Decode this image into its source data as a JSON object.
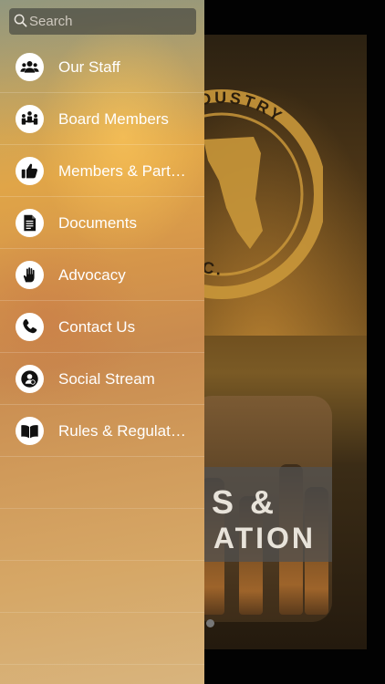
{
  "search": {
    "placeholder": "Search",
    "value": ""
  },
  "menu": {
    "items": [
      {
        "label": "Our Staff",
        "icon": "staff-group-icon"
      },
      {
        "label": "Board Members",
        "icon": "board-members-icon"
      },
      {
        "label": "Members & Part…",
        "icon": "thumbs-up-icon"
      },
      {
        "label": "Documents",
        "icon": "document-icon"
      },
      {
        "label": "Advocacy",
        "icon": "raised-hand-icon"
      },
      {
        "label": "Contact Us",
        "icon": "phone-icon"
      },
      {
        "label": "Social Stream",
        "icon": "user-chat-icon"
      },
      {
        "label": "Rules & Regulat…",
        "icon": "open-book-icon"
      }
    ]
  },
  "background": {
    "emblem_text_top": "DUSTRY",
    "emblem_text_bottom": "DA, INC.",
    "card_line1": "S &",
    "card_line2": "ATION"
  },
  "colors": {
    "drawer_text": "#ffffff",
    "icon_circle": "#ffffff",
    "emblem_gold": "#c9973a"
  }
}
